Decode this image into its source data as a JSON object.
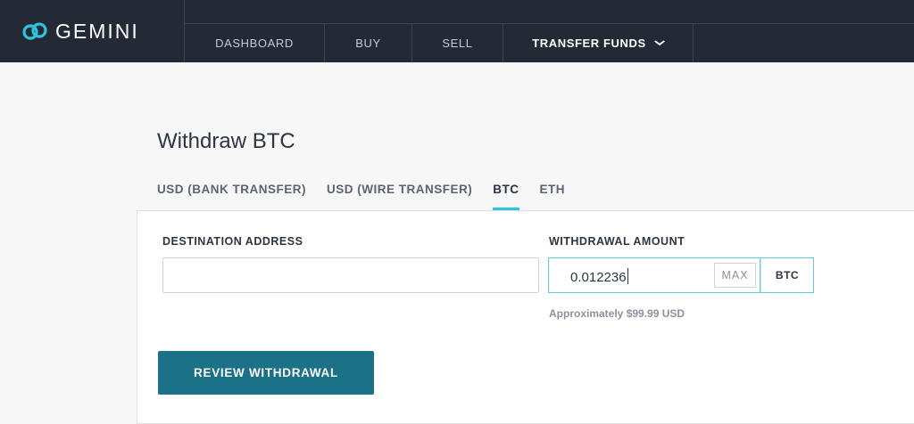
{
  "brand": {
    "name": "GEMINI",
    "accent": "#2ec4dc",
    "button_color": "#1b7187",
    "header_bg": "#232a35"
  },
  "nav": {
    "items": [
      {
        "label": "DASHBOARD"
      },
      {
        "label": "BUY"
      },
      {
        "label": "SELL"
      },
      {
        "label": "TRANSFER FUNDS",
        "active": true,
        "icon": "chevron-down-icon"
      }
    ]
  },
  "page": {
    "title": "Withdraw BTC"
  },
  "tabs": [
    {
      "label": "USD (BANK TRANSFER)"
    },
    {
      "label": "USD (WIRE TRANSFER)"
    },
    {
      "label": "BTC",
      "active": true
    },
    {
      "label": "ETH"
    }
  ],
  "form": {
    "destination": {
      "label": "DESTINATION ADDRESS",
      "value": "",
      "placeholder": ""
    },
    "amount": {
      "label": "WITHDRAWAL AMOUNT",
      "value": "0.012236",
      "max_label": "MAX",
      "unit": "BTC",
      "approx": "Approximately $99.99 USD"
    },
    "submit_label": "REVIEW WITHDRAWAL"
  }
}
